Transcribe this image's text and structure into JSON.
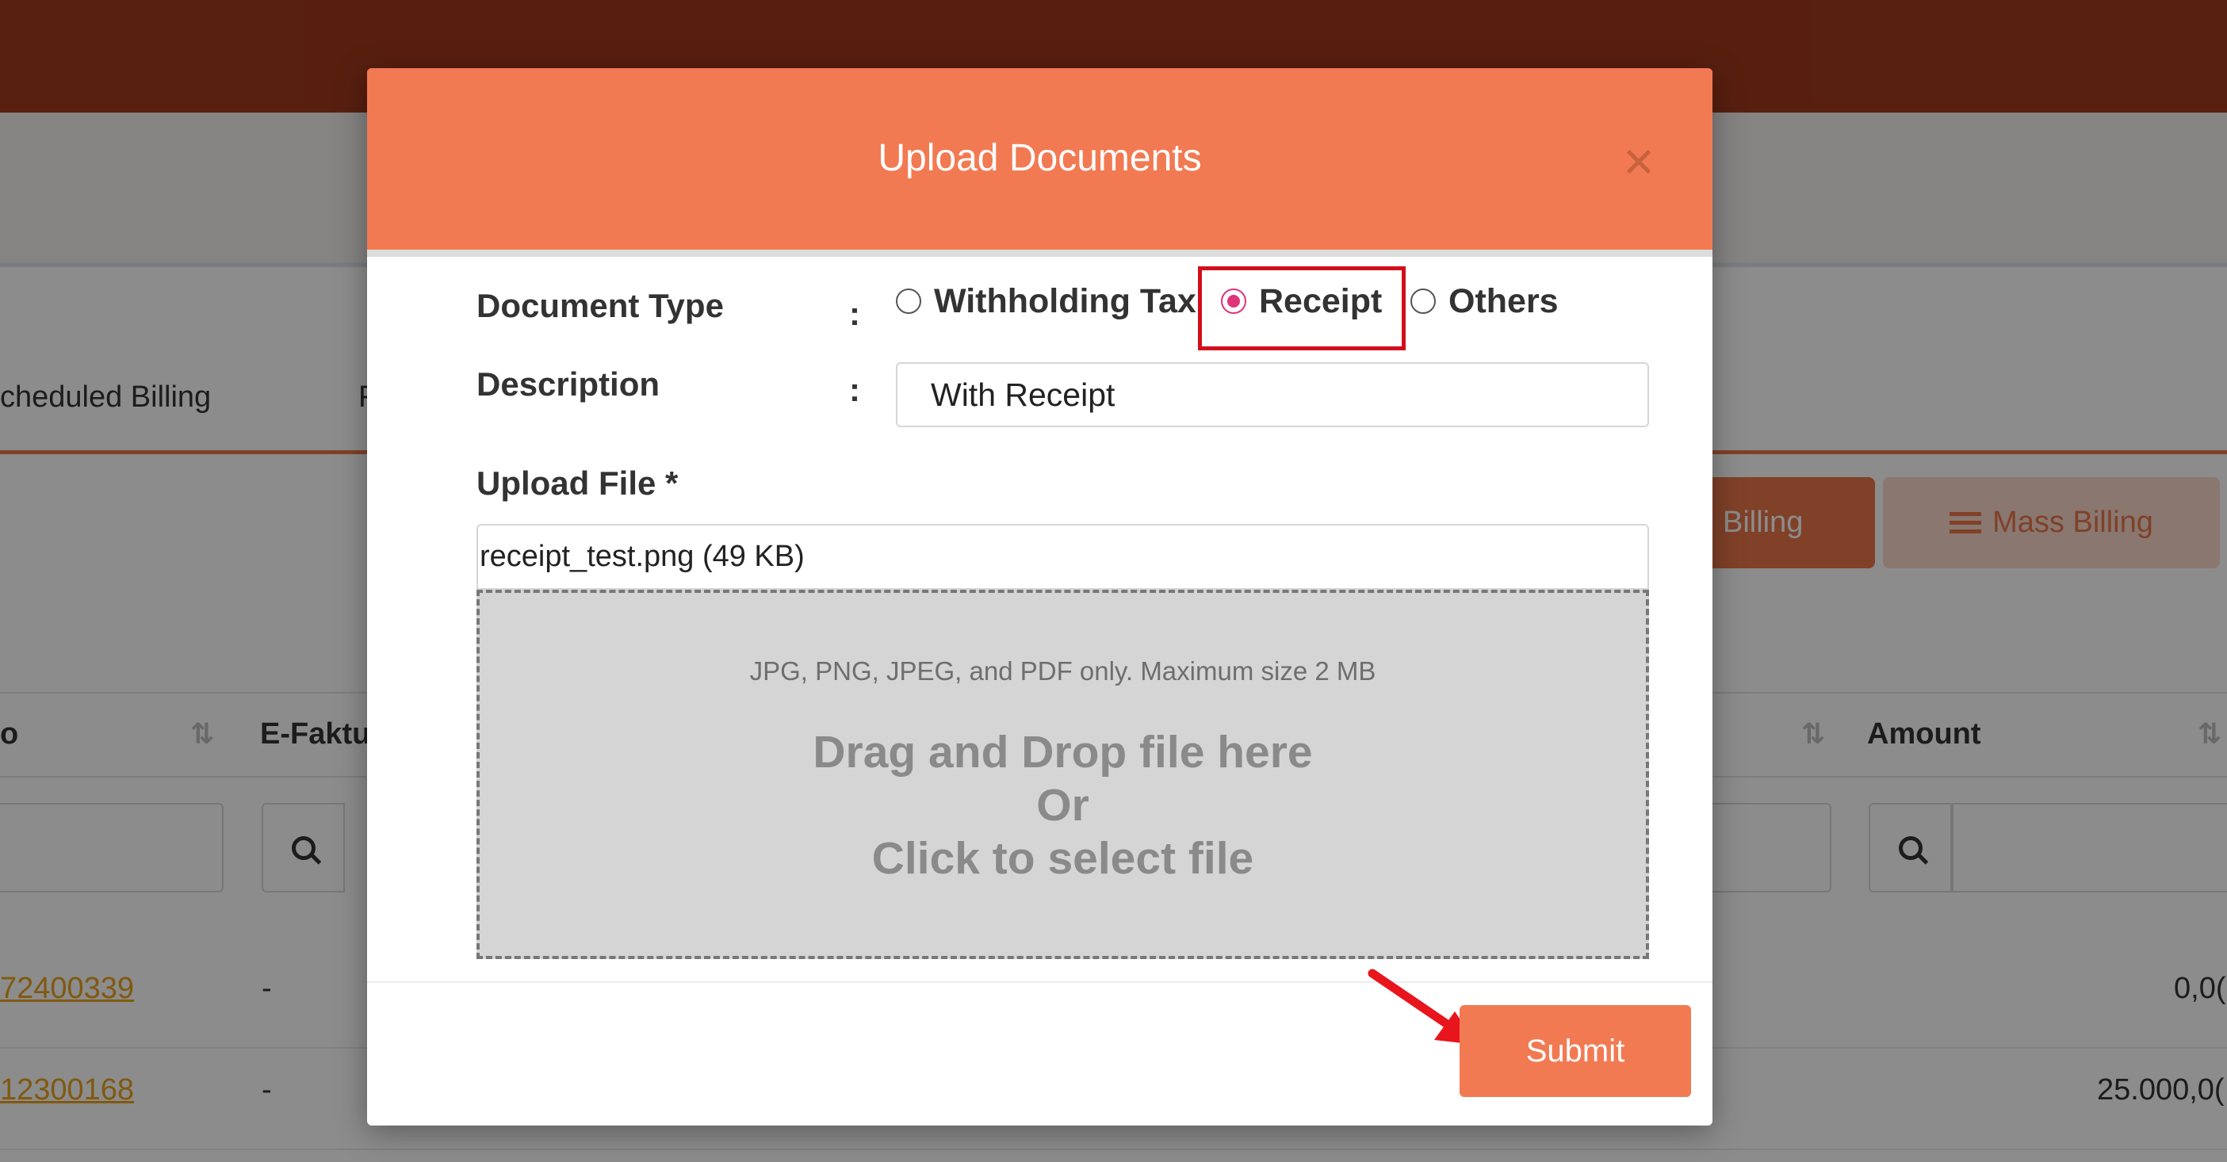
{
  "background": {
    "tabs": [
      "cheduled Billing",
      "F"
    ],
    "buttons": {
      "billing": "Billing",
      "mass_billing": "Mass Billing",
      "mass_billing_icon": "list-icon"
    },
    "table": {
      "headers": [
        "o",
        "E-Faktu",
        "Amount"
      ],
      "rows": [
        {
          "number": "72400339",
          "efaktur": "-",
          "amount": "0,0("
        },
        {
          "number": "12300168",
          "efaktur": "-",
          "amount": "25.000,0("
        }
      ]
    }
  },
  "modal": {
    "title": "Upload Documents",
    "close_icon": "close-icon",
    "document_type": {
      "label": "Document Type",
      "colon": ":",
      "options": [
        {
          "label": "Withholding Tax",
          "checked": false
        },
        {
          "label": "Receipt",
          "checked": true
        },
        {
          "label": "Others",
          "checked": false
        }
      ]
    },
    "description": {
      "label": "Description",
      "colon": ":",
      "value": "With Receipt"
    },
    "upload": {
      "label": "Upload File *",
      "file_display": "receipt_test.png (49 KB)",
      "hint": "JPG, PNG, JPEG, and PDF only. Maximum size 2 MB",
      "drop_line1": "Drag and Drop file here",
      "drop_line2": "Or",
      "drop_line3": "Click to select file"
    },
    "submit_label": "Submit"
  },
  "colors": {
    "header": "#f27a53",
    "accent": "#f27a53",
    "radio_checked": "#e0337a",
    "annotation_red": "#d20f1b"
  }
}
